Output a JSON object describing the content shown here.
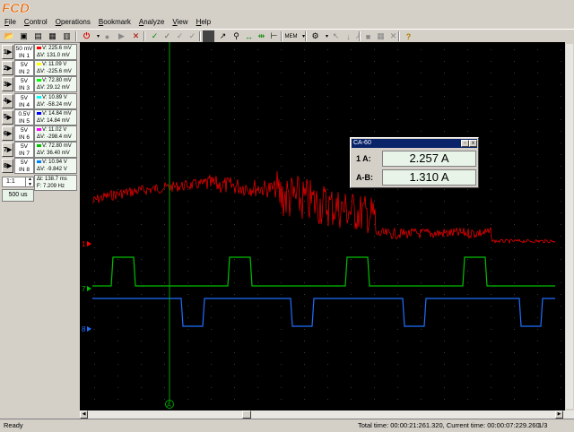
{
  "app": {
    "logo": "FCD"
  },
  "menu": [
    {
      "label": "File",
      "ul": "F",
      "rest": "ile"
    },
    {
      "label": "Control",
      "ul": "C",
      "rest": "ontrol"
    },
    {
      "label": "Operations",
      "ul": "O",
      "rest": "perations"
    },
    {
      "label": "Bookmark",
      "ul": "B",
      "rest": "ookmark"
    },
    {
      "label": "Analyze",
      "ul": "A",
      "rest": "nalyze"
    },
    {
      "label": "View",
      "ul": "V",
      "rest": "iew"
    },
    {
      "label": "Help",
      "ul": "H",
      "rest": "elp"
    }
  ],
  "channels": [
    {
      "btn": "1",
      "scale": "50 mV",
      "input": "IN 1",
      "r1": "V: 225.6 mV",
      "r2": "ΔV: 131.0 mV",
      "color": "#ff0000"
    },
    {
      "btn": "2",
      "scale": "5V",
      "input": "IN 2",
      "r1": "V: 11.09 V",
      "r2": "ΔV: -225.6 mV",
      "color": "#ffff00"
    },
    {
      "btn": "3",
      "scale": "5V",
      "input": "IN 3",
      "r1": "V: 72.80 mV",
      "r2": "ΔV: 29.12 mV",
      "color": "#00ff00"
    },
    {
      "btn": "4",
      "scale": "5V",
      "input": "IN 4",
      "r1": "V: 10.89 V",
      "r2": "ΔV: -58.24 mV",
      "color": "#00ffff"
    },
    {
      "btn": "5",
      "scale": "0.5V",
      "input": "IN 5",
      "r1": "V: 14.84 mV",
      "r2": "ΔV: 14.84 mV",
      "color": "#0000ff"
    },
    {
      "btn": "6",
      "scale": "5V",
      "input": "IN 6",
      "r1": "V: 11.02 V",
      "r2": "ΔV: -298.4 mV",
      "color": "#ff00ff"
    },
    {
      "btn": "7",
      "scale": "5V",
      "input": "IN 7",
      "r1": "V: 72.80 mV",
      "r2": "ΔV: 36.40 mV",
      "color": "#00c000"
    },
    {
      "btn": "8",
      "scale": "5V",
      "input": "IN 8",
      "r1": "V: 10.94 V",
      "r2": "ΔV: -9.842 V",
      "color": "#0080ff"
    }
  ],
  "timing": {
    "r1": "Δt: 138.7 ms",
    "r2": "F: 7.209 Hz"
  },
  "zoom": "1:1",
  "timebase": "500 us",
  "markers": {
    "ch1": "1",
    "ch7": "7",
    "ch8": "8",
    "cursor": "A"
  },
  "ca60": {
    "title": "CA-60",
    "row1_label": "1  A:",
    "row1_value": "2.257 A",
    "row2_label": "A-B:",
    "row2_value": "1.310 A",
    "min_btn": "-",
    "close_btn": "x"
  },
  "status": {
    "ready": "Ready",
    "times": "Total time: 00:00:21:261.320,  Current time: 00:00:07:229.260",
    "page": "1/3"
  },
  "colors": {
    "ch1": "#ff0000",
    "ch7": "#00c000",
    "ch8": "#1e6fff",
    "cursor": "#00a000",
    "grid": "#3a3a3a"
  }
}
